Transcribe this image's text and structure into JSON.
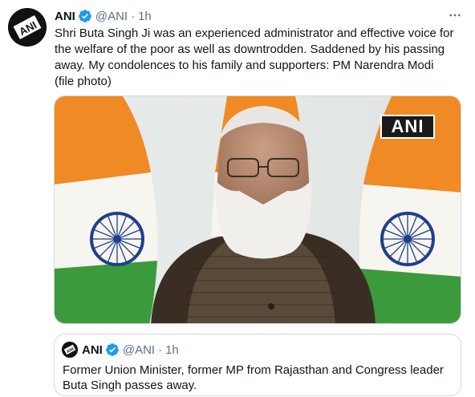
{
  "tweet": {
    "author_name": "ANI",
    "handle": "@ANI",
    "separator": "·",
    "time": "1h",
    "text": "Shri Buta Singh Ji was an experienced administrator and effective voice for the welfare of the poor as well as downtrodden. Saddened by his passing away. My condolences to his family and supporters: PM Narendra Modi (file photo)",
    "media_watermark": "ANI",
    "avatar_logo_text": "ANI"
  },
  "quoted_tweet": {
    "author_name": "ANI",
    "handle": "@ANI",
    "separator": "·",
    "time": "1h",
    "text": "Former Union Minister, former MP from Rajasthan and Congress leader Buta Singh passes away.",
    "avatar_logo_text": "ANI"
  },
  "colors": {
    "verified": "#1d9bf0",
    "secondary_text": "#5b7083",
    "saffron": "#f08a24",
    "green": "#3b9a3c",
    "chakra_blue": "#1f3f8c"
  },
  "icons": {
    "verified": "verified-badge-icon",
    "more": "more-options-icon"
  }
}
